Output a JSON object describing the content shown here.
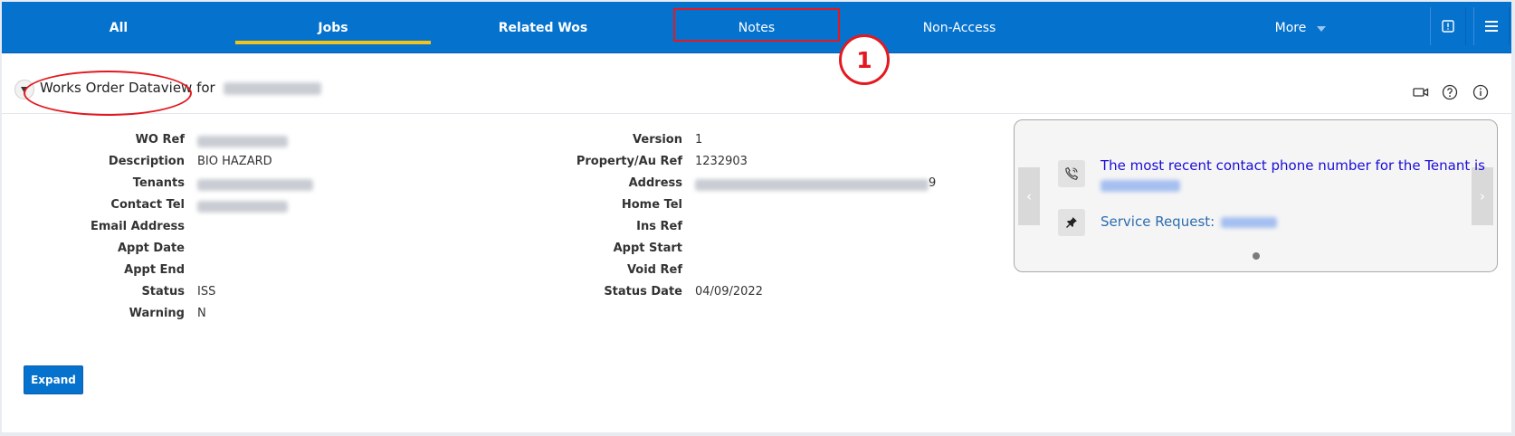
{
  "nav": {
    "tabs": [
      {
        "label": "All",
        "bold": true
      },
      {
        "label": "Jobs",
        "bold": true,
        "active": true
      },
      {
        "label": "Related Wos",
        "bold": true
      },
      {
        "label": "Notes",
        "bold": false
      },
      {
        "label": "Non-Access",
        "bold": false
      }
    ],
    "more_label": "More",
    "accent": "#0572ce",
    "active_underline": "#f0c419"
  },
  "annotation": {
    "step_number": "1",
    "color": "#e3191f"
  },
  "region": {
    "title": "Works Order Dataview for"
  },
  "form": {
    "left": [
      {
        "label": "WO Ref",
        "value": ""
      },
      {
        "label": "Description",
        "value": "BIO HAZARD"
      },
      {
        "label": "Tenants",
        "value": ""
      },
      {
        "label": "Contact Tel",
        "value": ""
      },
      {
        "label": "Email Address",
        "value": ""
      },
      {
        "label": "Appt Date",
        "value": ""
      },
      {
        "label": "Appt End",
        "value": ""
      },
      {
        "label": "Status",
        "value": "ISS"
      },
      {
        "label": "Warning",
        "value": "N"
      }
    ],
    "right": [
      {
        "label": "Version",
        "value": "1"
      },
      {
        "label": "Property/Au Ref",
        "value": "1232903"
      },
      {
        "label": "Address",
        "value": "9"
      },
      {
        "label": "Home Tel",
        "value": ""
      },
      {
        "label": "Ins Ref",
        "value": ""
      },
      {
        "label": "Appt Start",
        "value": ""
      },
      {
        "label": "Void Ref",
        "value": ""
      },
      {
        "label": "Status Date",
        "value": "04/09/2022"
      }
    ]
  },
  "card": {
    "phone_text": "The most recent contact phone number for the Tenant is",
    "service_request_label": "Service Request:",
    "phone_color": "#1a0dd8",
    "link_color": "#2b6cb0",
    "prev": "‹",
    "next": "›"
  },
  "expand_label": "Expand"
}
